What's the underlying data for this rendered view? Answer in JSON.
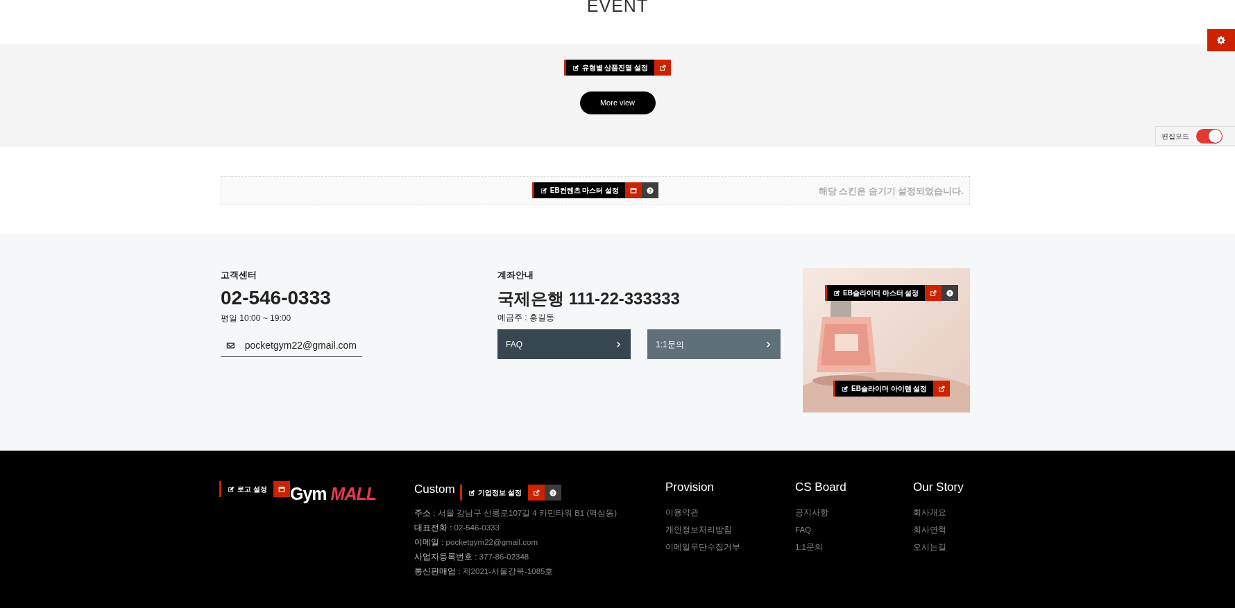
{
  "event_section": {
    "title": "EVENT"
  },
  "edit_mode": {
    "label": "편집모드",
    "on": true
  },
  "product_section": {
    "admin_bar": {
      "label": "유형별 상품진열 설정",
      "buttons": [
        {
          "kind": "link"
        }
      ]
    },
    "more_button": "More view"
  },
  "content_master": {
    "admin_bar": {
      "label": "EB컨텐츠 마스터 설정",
      "buttons": [
        {
          "kind": "window"
        },
        {
          "kind": "help"
        }
      ]
    },
    "notice": "해당 스킨은 숨기기 설정되었습니다."
  },
  "customer_center": {
    "title": "고객센터",
    "phone": "02-546-0333",
    "hours": "평일 10:00 ~ 19:00",
    "email": "pocketgym22@gmail.com"
  },
  "bank": {
    "title": "계좌안내",
    "account": "국제은행 111-22-333333",
    "holder": "예금주 : 홍길동",
    "links": [
      {
        "label": "FAQ",
        "kind": "dark"
      },
      {
        "label": "1:1문의",
        "kind": "light"
      }
    ]
  },
  "slider": {
    "kind": "picture",
    "admin_bars": [
      {
        "label": "EB슬라이더 마스터 설정",
        "buttons": [
          {
            "kind": "link"
          },
          {
            "kind": "help"
          }
        ]
      },
      {
        "label": "EB슬라이더 아이템 설정",
        "buttons": [
          {
            "kind": "link"
          }
        ]
      }
    ]
  },
  "footer": {
    "logo": {
      "text": "Gym",
      "accent": "MALL",
      "admin_bar": {
        "label": "로고 설정",
        "buttons": [
          {
            "kind": "window"
          }
        ]
      }
    },
    "company": {
      "heading": "Custom",
      "admin_bar": {
        "label": "기업정보 설정",
        "buttons": [
          {
            "kind": "link"
          },
          {
            "kind": "help"
          }
        ]
      },
      "lines": [
        {
          "label": "주소 :",
          "value": "서울 강남구 선릉로107길 4 카민타워 B1 (역삼동)"
        },
        {
          "label": "대표전화 :",
          "value": "02-546-0333"
        },
        {
          "label": "이메일 :",
          "value": "pocketgym22@gmail.com"
        },
        {
          "label": "사업자등록번호 :",
          "value": "377-86-02348"
        },
        {
          "label": "통신판매업 :",
          "value": "제2021-서울강북-1085호"
        }
      ]
    },
    "columns": [
      {
        "title": "Provision",
        "links": [
          "이용약관",
          "개인정보처리방침",
          "이메일무단수집거부"
        ]
      },
      {
        "title": "CS Board",
        "links": [
          "공지사항",
          "FAQ",
          "1:1문의"
        ]
      },
      {
        "title": "Our Story",
        "links": [
          "회사개요",
          "회사연혁",
          "오시는길"
        ]
      }
    ]
  }
}
